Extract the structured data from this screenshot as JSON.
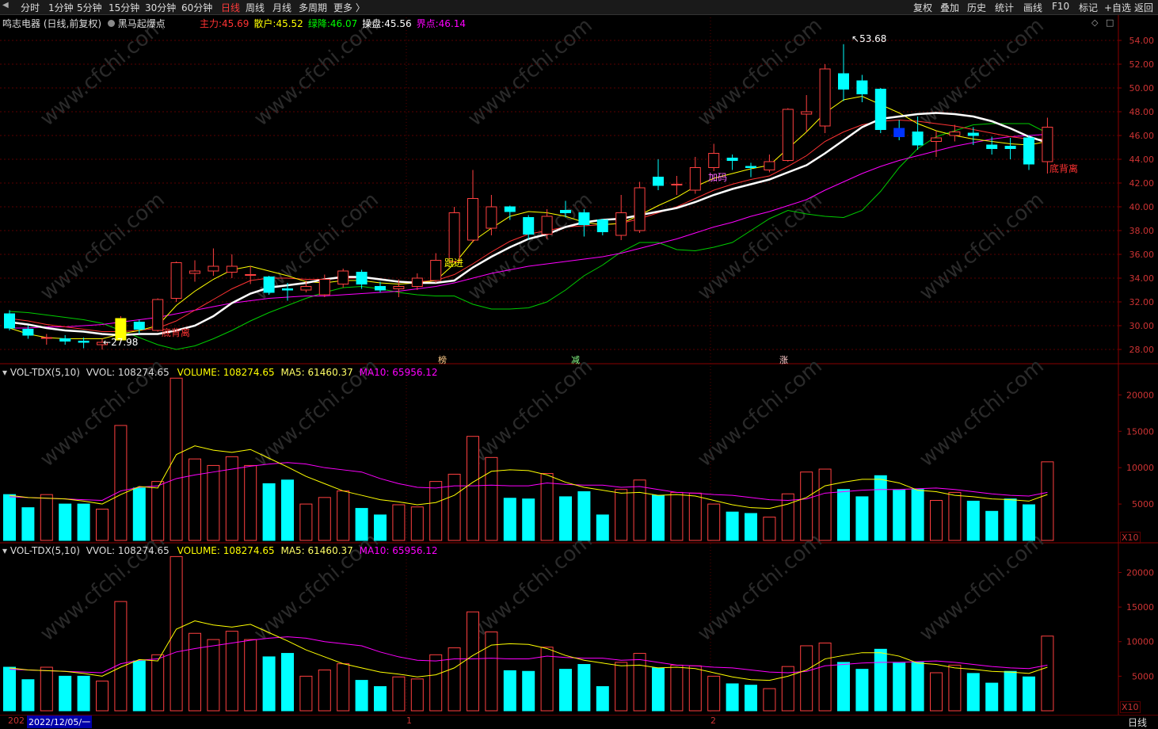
{
  "toolbar": {
    "nav_icon": "left-arrow-icon",
    "periods": [
      "分时",
      "1分钟",
      "5分钟",
      "15分钟",
      "30分钟",
      "60分钟",
      "日线",
      "周线",
      "月线",
      "多周期",
      "更多 〉"
    ],
    "active_period": "日线",
    "right_items": [
      "复权",
      "叠加",
      "历史",
      "统计",
      "画线",
      "F10",
      "标记",
      "+自选",
      "返回"
    ]
  },
  "header": {
    "stock": "鸣志电器",
    "mode": "(日线,前复权)",
    "indicator": "黑马起爆点",
    "params": [
      {
        "label": "主力:",
        "value": "45.69",
        "color": "#ff3333"
      },
      {
        "label": "散户:",
        "value": "45.52",
        "color": "#ffff00"
      },
      {
        "label": "绿降:",
        "value": "46.07",
        "color": "#00ff00"
      },
      {
        "label": "操盘:",
        "value": "45.56",
        "color": "#ffffff"
      },
      {
        "label": "界点:",
        "value": "46.14",
        "color": "#ff00ff"
      }
    ]
  },
  "panels": [
    {
      "title": "VOL-TDX(5,10)",
      "vvol": "VVOL: 108274.65",
      "volume": "VOLUME: 108274.65",
      "ma5": "MA5: 61460.37",
      "ma10": "MA10: 65956.12"
    },
    {
      "title": "VOL-TDX(5,10)",
      "vvol": "VVOL: 108274.65",
      "volume": "VOLUME: 108274.65",
      "ma5": "MA5: 61460.37",
      "ma10": "MA10: 65956.12"
    }
  ],
  "footer": {
    "date_prefix": "202",
    "date_label": "2022/12/05/一",
    "mark1": "1",
    "mark2": "2",
    "period": "日线"
  },
  "annotations": {
    "high": "53.68",
    "low": "27.98",
    "bottom_div1": "底背离",
    "bottom_div2": "底背离",
    "jiama": "加码",
    "genjin": "跟进",
    "signals": [
      "榜",
      "减",
      "涨"
    ]
  },
  "vol_unit": "X10",
  "colors": {
    "up": "#ff4040",
    "down": "#00ffff",
    "ma_white": "#ffffff",
    "ma_yellow": "#ffff00",
    "ma_red": "#ff3333",
    "ma_green": "#00cc00",
    "ma_magenta": "#ff00ff",
    "grid": "#5a0000"
  },
  "chart_data": {
    "type": "candlestick",
    "price_axis": {
      "min": 27,
      "max": 55,
      "ticks": [
        28,
        30,
        32,
        34,
        36,
        38,
        40,
        42,
        44,
        46,
        48,
        50,
        52,
        54
      ]
    },
    "volume_axis": {
      "min": 0,
      "max": 22000,
      "ticks": [
        5000,
        10000,
        15000,
        20000
      ],
      "unit": "X10"
    },
    "candles": [
      {
        "o": 31.0,
        "c": 29.8,
        "h": 31.3,
        "l": 29.6,
        "v": 6300
      },
      {
        "o": 29.7,
        "c": 29.2,
        "h": 30.0,
        "l": 28.9,
        "v": 4500
      },
      {
        "o": 29.0,
        "c": 29.0,
        "h": 29.3,
        "l": 28.4,
        "v": 6300
      },
      {
        "o": 28.9,
        "c": 28.7,
        "h": 29.2,
        "l": 28.4,
        "v": 5000
      },
      {
        "o": 28.7,
        "c": 28.6,
        "h": 29.0,
        "l": 28.1,
        "v": 5000
      },
      {
        "o": 28.4,
        "c": 28.6,
        "h": 28.9,
        "l": 27.98,
        "v": 4300
      },
      {
        "o": 28.8,
        "c": 30.6,
        "h": 30.8,
        "l": 28.7,
        "v": 15800
      },
      {
        "o": 30.3,
        "c": 29.7,
        "h": 30.5,
        "l": 29.3,
        "v": 7200
      },
      {
        "o": 29.6,
        "c": 32.2,
        "h": 32.3,
        "l": 29.5,
        "v": 8100
      },
      {
        "o": 32.3,
        "c": 35.3,
        "h": 35.4,
        "l": 32.0,
        "v": 22300
      },
      {
        "o": 34.4,
        "c": 34.6,
        "h": 35.5,
        "l": 33.7,
        "v": 11200
      },
      {
        "o": 34.6,
        "c": 35.0,
        "h": 36.5,
        "l": 34.2,
        "v": 10300
      },
      {
        "o": 34.5,
        "c": 35.0,
        "h": 36.0,
        "l": 34.0,
        "v": 11500
      },
      {
        "o": 34.3,
        "c": 34.3,
        "h": 35.0,
        "l": 33.5,
        "v": 10300
      },
      {
        "o": 34.1,
        "c": 32.8,
        "h": 34.2,
        "l": 32.6,
        "v": 7800
      },
      {
        "o": 33.1,
        "c": 33.0,
        "h": 33.6,
        "l": 32.1,
        "v": 8300
      },
      {
        "o": 33.0,
        "c": 33.3,
        "h": 33.8,
        "l": 32.8,
        "v": 5000
      },
      {
        "o": 32.6,
        "c": 33.9,
        "h": 34.3,
        "l": 32.4,
        "v": 5900
      },
      {
        "o": 33.5,
        "c": 34.6,
        "h": 34.8,
        "l": 33.2,
        "v": 6800
      },
      {
        "o": 34.5,
        "c": 33.5,
        "h": 34.7,
        "l": 33.1,
        "v": 4400
      },
      {
        "o": 33.3,
        "c": 33.0,
        "h": 33.7,
        "l": 32.8,
        "v": 3500
      },
      {
        "o": 33.1,
        "c": 33.3,
        "h": 33.9,
        "l": 32.4,
        "v": 4900
      },
      {
        "o": 33.3,
        "c": 34.0,
        "h": 34.4,
        "l": 33.0,
        "v": 4600
      },
      {
        "o": 33.8,
        "c": 35.5,
        "h": 36.1,
        "l": 33.6,
        "v": 8100
      },
      {
        "o": 35.4,
        "c": 39.5,
        "h": 40.0,
        "l": 35.3,
        "v": 9100
      },
      {
        "o": 37.2,
        "c": 40.7,
        "h": 43.1,
        "l": 37.0,
        "v": 14300
      },
      {
        "o": 38.2,
        "c": 40.0,
        "h": 41.0,
        "l": 37.6,
        "v": 11400
      },
      {
        "o": 40.0,
        "c": 39.6,
        "h": 40.1,
        "l": 38.9,
        "v": 5800
      },
      {
        "o": 39.1,
        "c": 37.7,
        "h": 39.3,
        "l": 37.2,
        "v": 5700
      },
      {
        "o": 37.7,
        "c": 39.2,
        "h": 39.8,
        "l": 37.3,
        "v": 9200
      },
      {
        "o": 39.7,
        "c": 39.5,
        "h": 40.5,
        "l": 39.1,
        "v": 6000
      },
      {
        "o": 39.5,
        "c": 38.5,
        "h": 39.8,
        "l": 37.5,
        "v": 6700
      },
      {
        "o": 38.9,
        "c": 37.9,
        "h": 39.0,
        "l": 37.6,
        "v": 3500
      },
      {
        "o": 37.6,
        "c": 39.5,
        "h": 41.0,
        "l": 37.2,
        "v": 7000
      },
      {
        "o": 38.0,
        "c": 41.6,
        "h": 42.1,
        "l": 37.8,
        "v": 8300
      },
      {
        "o": 42.5,
        "c": 41.8,
        "h": 44.0,
        "l": 41.4,
        "v": 6200
      },
      {
        "o": 41.9,
        "c": 41.9,
        "h": 42.6,
        "l": 41.0,
        "v": 6600
      },
      {
        "o": 41.4,
        "c": 43.3,
        "h": 44.2,
        "l": 41.1,
        "v": 6500
      },
      {
        "o": 43.3,
        "c": 44.5,
        "h": 45.3,
        "l": 43.0,
        "v": 5000
      },
      {
        "o": 44.1,
        "c": 43.9,
        "h": 44.4,
        "l": 43.1,
        "v": 3900
      },
      {
        "o": 43.4,
        "c": 43.3,
        "h": 43.7,
        "l": 42.5,
        "v": 3700
      },
      {
        "o": 43.1,
        "c": 43.8,
        "h": 44.4,
        "l": 42.9,
        "v": 3200
      },
      {
        "o": 43.9,
        "c": 48.2,
        "h": 48.3,
        "l": 43.8,
        "v": 6400
      },
      {
        "o": 47.8,
        "c": 48.0,
        "h": 49.4,
        "l": 46.3,
        "v": 9400
      },
      {
        "o": 46.8,
        "c": 51.6,
        "h": 52.0,
        "l": 46.2,
        "v": 9800
      },
      {
        "o": 51.2,
        "c": 49.9,
        "h": 53.68,
        "l": 48.9,
        "v": 7000
      },
      {
        "o": 50.6,
        "c": 49.5,
        "h": 51.1,
        "l": 48.8,
        "v": 6000
      },
      {
        "o": 49.9,
        "c": 46.5,
        "h": 50.0,
        "l": 46.2,
        "v": 8900
      },
      {
        "o": 46.6,
        "c": 45.9,
        "h": 47.3,
        "l": 45.6,
        "v": 6900
      },
      {
        "o": 46.3,
        "c": 45.2,
        "h": 47.6,
        "l": 44.8,
        "v": 7000
      },
      {
        "o": 45.5,
        "c": 45.8,
        "h": 46.4,
        "l": 44.2,
        "v": 5500
      },
      {
        "o": 46.0,
        "c": 46.3,
        "h": 46.9,
        "l": 45.5,
        "v": 6600
      },
      {
        "o": 46.2,
        "c": 46.0,
        "h": 46.7,
        "l": 45.2,
        "v": 5400
      },
      {
        "o": 45.2,
        "c": 44.9,
        "h": 45.9,
        "l": 44.4,
        "v": 4000
      },
      {
        "o": 45.1,
        "c": 44.9,
        "h": 45.8,
        "l": 44.0,
        "v": 5700
      },
      {
        "o": 45.8,
        "c": 43.6,
        "h": 46.0,
        "l": 43.1,
        "v": 4900
      },
      {
        "o": 43.8,
        "c": 46.7,
        "h": 47.5,
        "l": 42.8,
        "v": 10800
      }
    ],
    "ma_white": [
      30.3,
      30.1,
      29.8,
      29.6,
      29.5,
      29.3,
      29.2,
      29.3,
      29.3,
      29.6,
      30.0,
      30.8,
      31.9,
      32.7,
      33.2,
      33.4,
      33.6,
      33.9,
      34.1,
      34.1,
      33.9,
      33.7,
      33.6,
      33.6,
      33.8,
      34.9,
      35.8,
      36.6,
      37.3,
      37.7,
      38.3,
      38.7,
      38.9,
      39.0,
      39.3,
      39.6,
      39.9,
      40.4,
      41.0,
      41.5,
      41.9,
      42.3,
      42.9,
      43.5,
      44.5,
      45.6,
      46.7,
      47.4,
      47.6,
      47.8,
      47.9,
      47.8,
      47.6,
      47.2,
      46.6,
      45.9,
      45.4
    ],
    "ma_yellow": [
      29.8,
      29.3,
      29.0,
      28.9,
      28.9,
      28.9,
      29.3,
      29.6,
      30.0,
      31.7,
      32.9,
      33.9,
      34.7,
      35.0,
      34.6,
      34.2,
      33.7,
      33.6,
      33.8,
      33.8,
      33.6,
      33.5,
      33.6,
      33.8,
      35.2,
      37.1,
      38.2,
      39.2,
      39.6,
      39.5,
      39.2,
      38.7,
      38.5,
      38.6,
      39.3,
      40.1,
      40.8,
      41.7,
      42.4,
      42.8,
      43.2,
      43.5,
      44.9,
      46.3,
      47.9,
      49.0,
      49.3,
      48.6,
      47.9,
      47.0,
      46.4,
      46.0,
      45.7,
      45.5,
      45.3,
      45.2,
      45.5
    ],
    "ma_red": [
      30.6,
      30.4,
      30.1,
      29.9,
      29.7,
      29.5,
      29.5,
      29.6,
      29.8,
      30.4,
      31.3,
      32.2,
      33.1,
      33.8,
      34.0,
      34.0,
      33.9,
      33.9,
      34.0,
      34.0,
      33.9,
      33.7,
      33.7,
      33.8,
      34.3,
      35.2,
      36.2,
      37.1,
      37.7,
      38.0,
      38.3,
      38.4,
      38.5,
      38.6,
      39.0,
      39.5,
      40.0,
      40.7,
      41.4,
      41.9,
      42.3,
      42.6,
      43.4,
      44.3,
      45.5,
      46.3,
      46.9,
      47.2,
      47.3,
      47.2,
      47.0,
      46.8,
      46.5,
      46.2,
      45.9,
      45.7,
      45.7
    ],
    "ma_green": [
      31.2,
      31.1,
      30.9,
      30.7,
      30.5,
      30.2,
      29.6,
      29.0,
      28.4,
      28.0,
      28.3,
      28.9,
      29.6,
      30.4,
      31.1,
      31.7,
      32.3,
      32.8,
      33.2,
      33.3,
      33.1,
      32.8,
      32.6,
      32.5,
      32.5,
      31.8,
      31.4,
      31.4,
      31.5,
      32.0,
      33.0,
      34.2,
      35.1,
      36.2,
      37.0,
      37.0,
      36.4,
      36.3,
      36.6,
      37.0,
      38.0,
      39.0,
      39.7,
      39.4,
      39.2,
      39.1,
      39.7,
      41.3,
      43.3,
      44.9,
      45.9,
      46.4,
      46.9,
      47.0,
      47.0,
      47.0,
      46.2
    ],
    "ma_magenta": [
      29.8,
      29.8,
      29.9,
      29.9,
      30.0,
      30.1,
      30.3,
      30.5,
      30.7,
      31.0,
      31.3,
      31.6,
      31.9,
      32.1,
      32.3,
      32.4,
      32.5,
      32.5,
      32.6,
      32.7,
      32.8,
      32.9,
      33.1,
      33.3,
      33.6,
      34.0,
      34.4,
      34.7,
      35.0,
      35.2,
      35.4,
      35.6,
      35.8,
      36.1,
      36.5,
      36.9,
      37.3,
      37.8,
      38.3,
      38.7,
      39.2,
      39.6,
      40.1,
      40.6,
      41.4,
      42.1,
      42.8,
      43.4,
      43.9,
      44.3,
      44.7,
      45.1,
      45.4,
      45.7,
      45.9,
      46.0,
      46.1
    ],
    "vol_ma5": [
      6200,
      5900,
      5800,
      5700,
      5400,
      5000,
      6300,
      7400,
      7200,
      11800,
      13000,
      12400,
      12100,
      12500,
      11300,
      10100,
      8800,
      7800,
      6800,
      6200,
      5600,
      5300,
      4900,
      5200,
      6200,
      8000,
      9500,
      9700,
      9600,
      9000,
      8000,
      7300,
      6900,
      6500,
      6600,
      6200,
      6300,
      6100,
      5500,
      4900,
      4500,
      4400,
      5000,
      5900,
      7500,
      8000,
      8400,
      8400,
      7900,
      6900,
      6700,
      6200,
      6000,
      5700,
      5600,
      5400,
      6300
    ],
    "vol_ma10": [
      6000,
      5900,
      5800,
      5700,
      5600,
      5500,
      6800,
      7300,
      7500,
      8500,
      9000,
      9400,
      9800,
      10200,
      10500,
      10700,
      10500,
      10000,
      9700,
      9400,
      8500,
      7800,
      7300,
      7200,
      7500,
      7500,
      7600,
      7500,
      7500,
      7900,
      7700,
      7600,
      7600,
      7300,
      7400,
      7000,
      6600,
      6500,
      6300,
      6200,
      5900,
      5600,
      5500,
      5700,
      6500,
      6700,
      6900,
      7000,
      7000,
      7100,
      7200,
      7000,
      6700,
      6400,
      6200,
      6100,
      6600
    ]
  }
}
